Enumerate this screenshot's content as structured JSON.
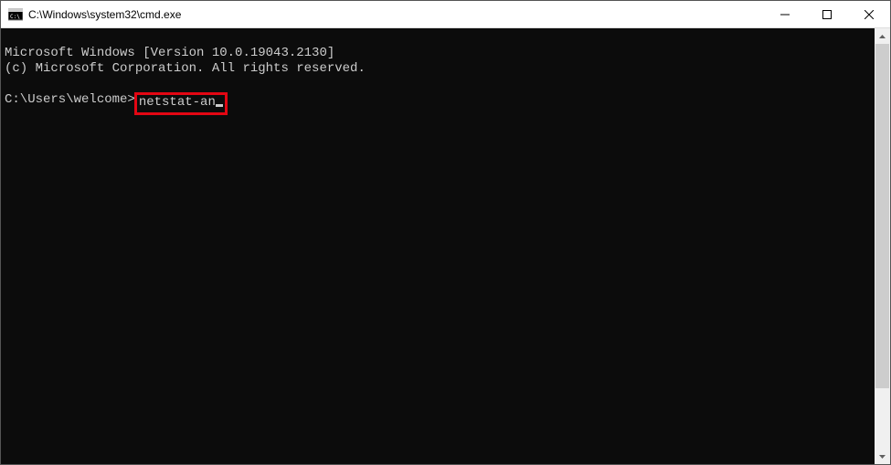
{
  "window": {
    "title": "C:\\Windows\\system32\\cmd.exe"
  },
  "terminal": {
    "line1": "Microsoft Windows [Version 10.0.19043.2130]",
    "line2": "(c) Microsoft Corporation. All rights reserved.",
    "prompt": "C:\\Users\\welcome>",
    "command": "netstat-an"
  }
}
